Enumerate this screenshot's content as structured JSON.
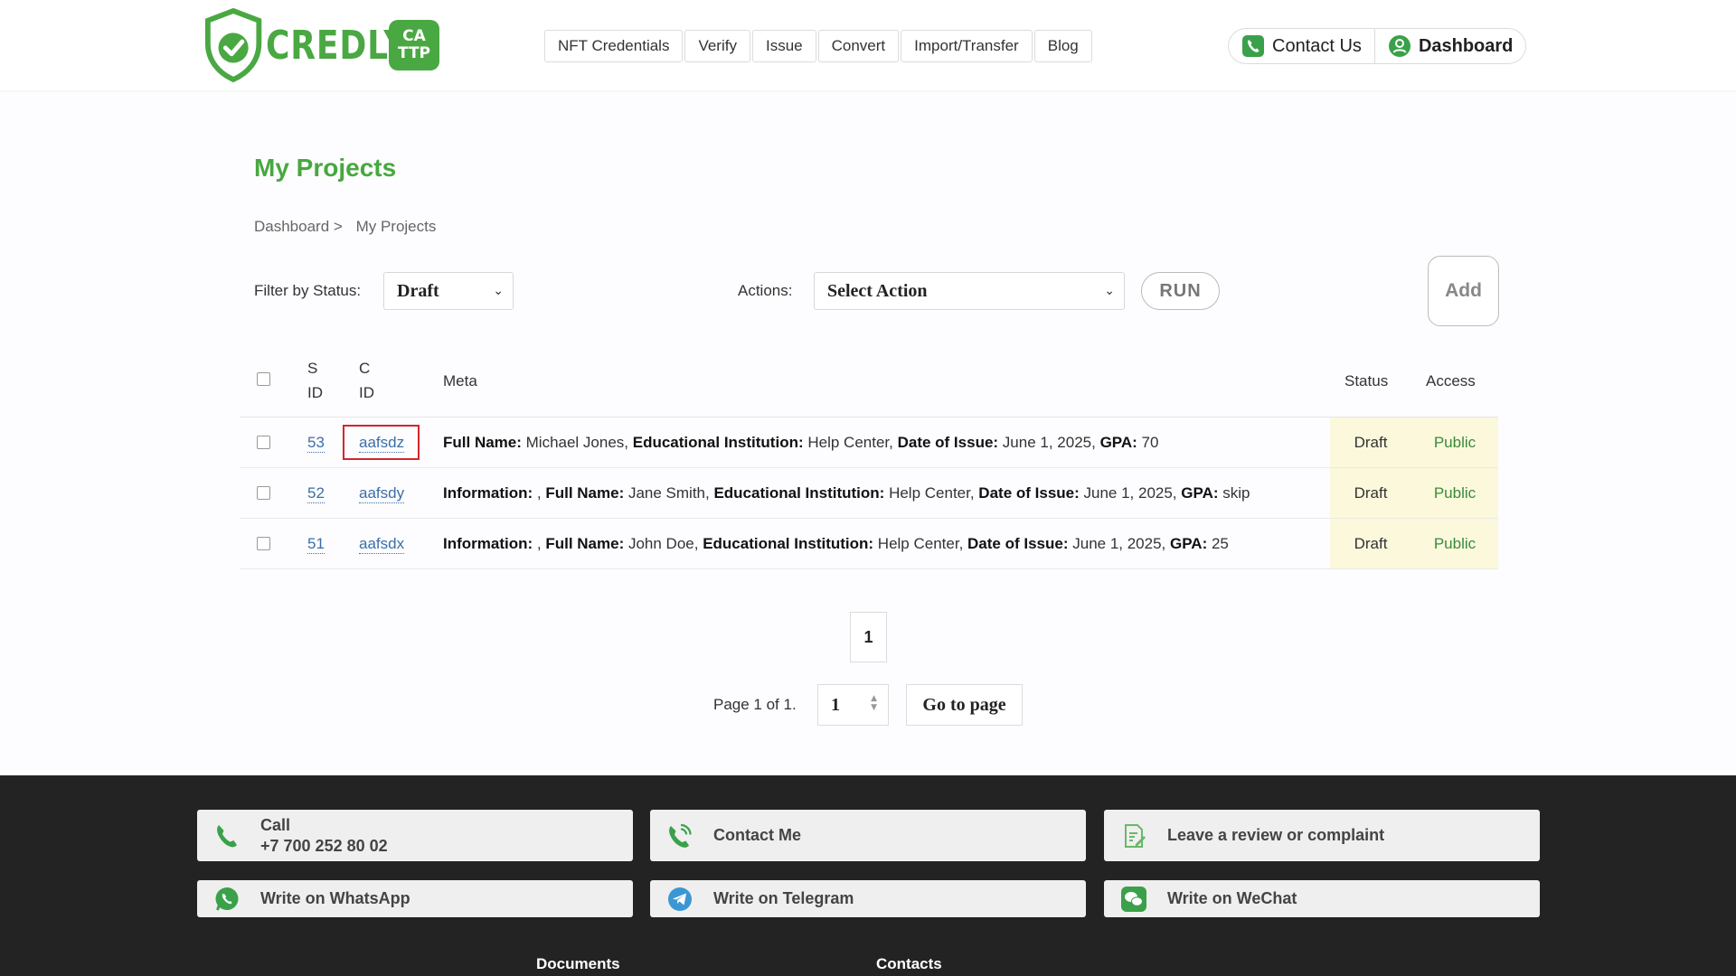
{
  "brand": {
    "name": "CREDLY",
    "badge_line1": "CA",
    "badge_line2": "TTP",
    "color": "#4aa843"
  },
  "nav": {
    "items": [
      {
        "label": "NFT Credentials"
      },
      {
        "label": "Verify"
      },
      {
        "label": "Issue"
      },
      {
        "label": "Convert"
      },
      {
        "label": "Import/Transfer"
      },
      {
        "label": "Blog"
      }
    ]
  },
  "header_actions": {
    "contact_label": "Contact Us",
    "contact_icon": "phone-icon",
    "dashboard_label": "Dashboard",
    "dashboard_icon": "user-icon"
  },
  "page": {
    "title": "My Projects",
    "breadcrumb": [
      {
        "label": "Dashboard >"
      },
      {
        "label": "My Projects"
      }
    ]
  },
  "filters": {
    "status_label": "Filter by Status:",
    "status_value": "Draft",
    "actions_label": "Actions:",
    "action_value": "Select Action",
    "run_label": "RUN",
    "add_label": "Add"
  },
  "table": {
    "headers": {
      "sid_line1": "S",
      "sid_line2": "ID",
      "cid_line1": "C",
      "cid_line2": "ID",
      "meta": "Meta",
      "status": "Status",
      "access": "Access"
    },
    "rows": [
      {
        "sid": "53",
        "cid": "aafsdz",
        "meta": [
          {
            "k": "Full Name:",
            "v": " Michael Jones, "
          },
          {
            "k": "Educational Institution:",
            "v": " Help Center, "
          },
          {
            "k": "Date of Issue:",
            "v": " June 1, 2025, "
          },
          {
            "k": "GPA:",
            "v": " 70"
          }
        ],
        "status": "Draft",
        "access": "Public"
      },
      {
        "sid": "52",
        "cid": "aafsdy",
        "meta": [
          {
            "k": "Information:",
            "v": " , "
          },
          {
            "k": "Full Name:",
            "v": " Jane Smith, "
          },
          {
            "k": "Educational Institution:",
            "v": " Help Center, "
          },
          {
            "k": "Date of Issue:",
            "v": " June 1, 2025, "
          },
          {
            "k": "GPA:",
            "v": " skip"
          }
        ],
        "status": "Draft",
        "access": "Public"
      },
      {
        "sid": "51",
        "cid": "aafsdx",
        "meta": [
          {
            "k": "Information:",
            "v": " , "
          },
          {
            "k": "Full Name:",
            "v": " John Doe, "
          },
          {
            "k": "Educational Institution:",
            "v": " Help Center, "
          },
          {
            "k": "Date of Issue:",
            "v": " June 1, 2025, "
          },
          {
            "k": "GPA:",
            "v": " 25"
          }
        ],
        "status": "Draft",
        "access": "Public"
      }
    ]
  },
  "pagination": {
    "current_page": "1",
    "page_of_text": "Page 1 of 1.",
    "input_value": "1",
    "goto_label": "Go to page"
  },
  "footer": {
    "call_label": "Call",
    "call_number": "+7 700 252 80 02",
    "contact_me": "Contact Me",
    "review": "Leave a review or complaint",
    "whatsapp": "Write on WhatsApp",
    "telegram": "Write on Telegram",
    "wechat": "Write on WeChat",
    "documents_heading": "Documents",
    "contacts_heading": "Contacts"
  },
  "colors": {
    "accent_green": "#47a83f",
    "link_blue": "#3b6fa8",
    "status_bg": "#fbf8dc",
    "footer_bg": "#232323",
    "highlight_red": "#d0282c"
  }
}
